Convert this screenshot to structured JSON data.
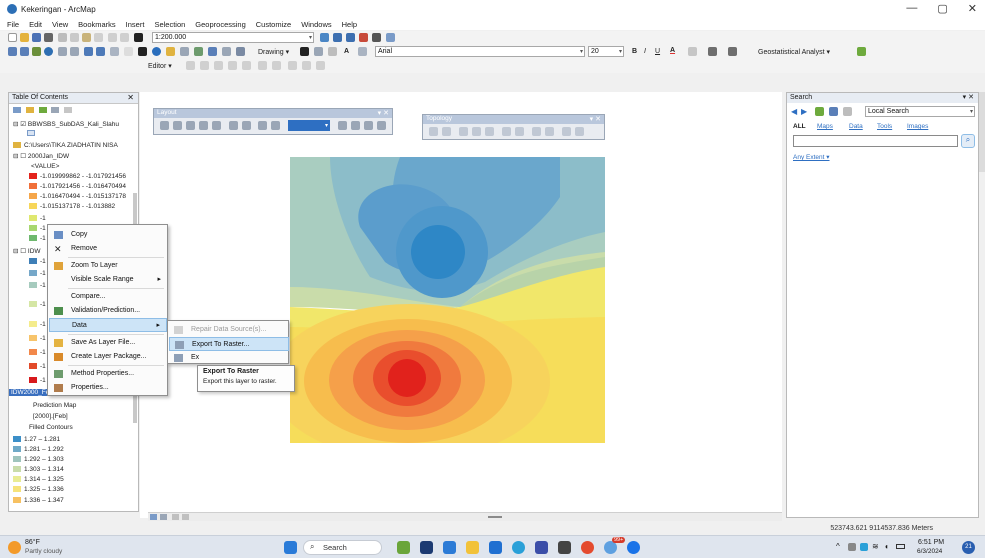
{
  "window": {
    "title": "Kekeringan - ArcMap",
    "controls": [
      "—",
      "▢",
      "✕"
    ]
  },
  "menubar": [
    "File",
    "Edit",
    "View",
    "Bookmarks",
    "Insert",
    "Selection",
    "Geoprocessing",
    "Customize",
    "Windows",
    "Help"
  ],
  "toolbar": {
    "scale": "1:200.000",
    "drawing_label": "Drawing ▾",
    "font": "Arial",
    "font_size": "20",
    "geostat": "Geostatistical Analyst ▾",
    "editor": "Editor ▾"
  },
  "toc": {
    "title": "Table Of Contents",
    "layers": [
      {
        "label": "BBWSBS_SubDAS_Kali_Slahu"
      },
      {
        "label": "C:\\Users\\TIKA ZIADHATIN NISA"
      },
      {
        "label": "2000Jan_IDW"
      },
      {
        "label": "<VALUE>"
      },
      {
        "label": "-1.019999862 - -1.017921456",
        "color": "#e3241c"
      },
      {
        "label": "-1.017921456 - -1.016470494",
        "color": "#f0703a"
      },
      {
        "label": "-1.016470494 - -1.015137178",
        "color": "#f5a64a"
      },
      {
        "label": "-1.015137178 - -1.013882",
        "color": "#f7d65a"
      },
      {
        "label": "-1",
        "color": "#dfe870"
      },
      {
        "label": "-1",
        "color": "#a8d770"
      },
      {
        "label": "-1",
        "color": "#6fb86e"
      },
      {
        "label": "IDW",
        "color": ""
      },
      {
        "label": "-1",
        "color": "#3e7fb7"
      },
      {
        "label": "-1",
        "color": "#76a8c9"
      },
      {
        "label": "-1",
        "color": "#a6cbbe"
      },
      {
        "label": "-1",
        "color": "#d5e6a5"
      },
      {
        "label": "-1",
        "color": "#f4ec8c"
      },
      {
        "label": "-1",
        "color": "#f7c46b"
      },
      {
        "label": "-1",
        "color": "#f2884a"
      },
      {
        "label": "-1",
        "color": "#e24a2a"
      },
      {
        "label": "-1",
        "color": "#d7191c"
      }
    ],
    "selected_layer": "IDW2000_Feb",
    "prediction": [
      "Prediction Map",
      "[2000].[Feb]",
      "Filled Contours"
    ],
    "contours": [
      {
        "label": "1.27 – 1.281",
        "color": "#3c8fc8"
      },
      {
        "label": "1.281 – 1.292",
        "color": "#6fa9c7"
      },
      {
        "label": "1.292 – 1.303",
        "color": "#9fc4bd"
      },
      {
        "label": "1.303 – 1.314",
        "color": "#c9dcaa"
      },
      {
        "label": "1.314 – 1.325",
        "color": "#e9ec94"
      },
      {
        "label": "1.325 – 1.336",
        "color": "#f6e37a"
      },
      {
        "label": "1.336 – 1.347",
        "color": "#f7c161"
      }
    ]
  },
  "context_menu": {
    "items": [
      {
        "label": "Copy",
        "icon": "copy-icon",
        "color": "#6a8fc5"
      },
      {
        "label": "Remove",
        "icon": "remove-icon",
        "color": "#333333"
      },
      {
        "label": "Zoom To Layer",
        "icon": "zoom-layer-icon",
        "color": "#e0a33a"
      },
      {
        "label": "Visible Scale Range",
        "icon": "",
        "color": "",
        "submenu": true
      },
      {
        "label": "Compare...",
        "icon": "",
        "color": ""
      },
      {
        "label": "Validation/Prediction...",
        "icon": "validation-icon",
        "color": "#4d8f4d"
      },
      {
        "label": "Data",
        "icon": "",
        "color": "",
        "submenu": true,
        "highlighted": true
      },
      {
        "label": "Save As Layer File...",
        "icon": "save-layer-icon",
        "color": "#e4b341"
      },
      {
        "label": "Create Layer Package...",
        "icon": "layer-package-icon",
        "color": "#d98a2a"
      },
      {
        "label": "Method Properties...",
        "icon": "method-properties-icon",
        "color": "#6d9b6d"
      },
      {
        "label": "Properties...",
        "icon": "properties-icon",
        "color": "#b07c4c"
      }
    ]
  },
  "data_submenu": {
    "items": [
      {
        "label": "Repair Data Source(s)...",
        "disabled": true
      },
      {
        "label": "Export To Raster...",
        "highlighted": true
      },
      {
        "label": "Ex"
      }
    ]
  },
  "tooltip": {
    "title": "Export To Raster",
    "text": "Export this layer to raster."
  },
  "floating_toolbars": {
    "layout": "Layout",
    "topology": "Topology"
  },
  "search": {
    "title": "Search",
    "scope": "Local Search",
    "tabs": [
      "ALL",
      "Maps",
      "Data",
      "Tools",
      "Images"
    ],
    "extent": "Any Extent ▾"
  },
  "status": {
    "coordinates": "523743.621  9114537.836 Meters"
  },
  "taskbar": {
    "weather_temp": "86°F",
    "weather_desc": "Partly cloudy",
    "search": "Search",
    "time": "6:51 PM",
    "date": "6/3/2024",
    "badge": "99+",
    "notif": "21"
  }
}
